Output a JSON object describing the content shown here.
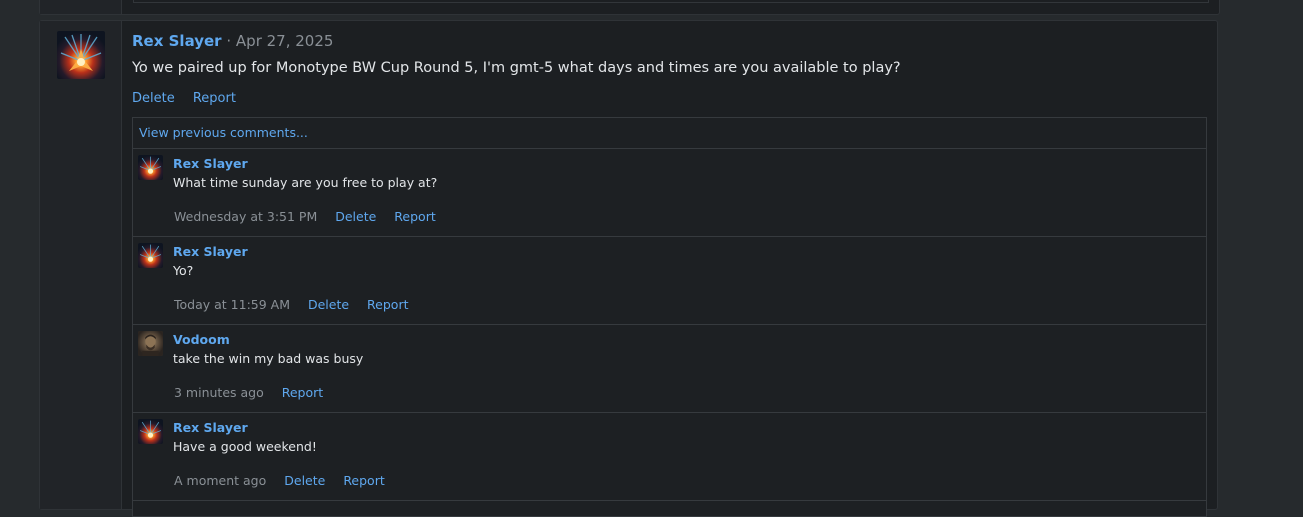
{
  "post": {
    "author": "Rex Slayer",
    "separator": "·",
    "date": "Apr 27, 2025",
    "body": "Yo we paired up for Monotype BW Cup Round 5, I'm gmt-5 what days and times are you available to play?",
    "actions": {
      "delete": "Delete",
      "report": "Report"
    }
  },
  "comments_section": {
    "view_previous": "View previous comments..."
  },
  "comments": [
    {
      "author": "Rex Slayer",
      "text": "What time sunday are you free to play at?",
      "time": "Wednesday at 3:51 PM",
      "delete": "Delete",
      "report": "Report",
      "avatar": "fire-burst-avatar"
    },
    {
      "author": "Rex Slayer",
      "text": "Yo?",
      "time": "Today at 11:59 AM",
      "delete": "Delete",
      "report": "Report",
      "avatar": "fire-burst-avatar"
    },
    {
      "author": "Vodoom",
      "text": "take the win my bad was busy",
      "time": "3 minutes ago",
      "report": "Report",
      "avatar": "person-portrait-avatar"
    },
    {
      "author": "Rex Slayer",
      "text": "Have a good weekend!",
      "time": "A moment ago",
      "delete": "Delete",
      "report": "Report",
      "avatar": "fire-burst-avatar"
    }
  ],
  "colors": {
    "accent": "#5fa8ef",
    "muted": "#8a9096",
    "background": "#262a2d",
    "panel": "#1c1f22"
  }
}
